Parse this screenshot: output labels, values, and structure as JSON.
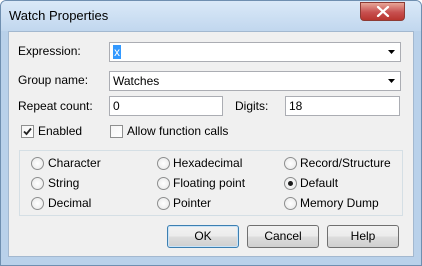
{
  "window": {
    "title": "Watch Properties"
  },
  "form": {
    "expression_label": "Expression:",
    "expression_value": "x",
    "group_label": "Group name:",
    "group_value": "Watches",
    "repeat_label": "Repeat count:",
    "repeat_value": "0",
    "digits_label": "Digits:",
    "digits_value": "18",
    "enabled_label": "Enabled",
    "enabled_checked": true,
    "allow_calls_label": "Allow function calls",
    "allow_calls_checked": false
  },
  "formats": {
    "options": [
      {
        "label": "Character",
        "selected": false
      },
      {
        "label": "Hexadecimal",
        "selected": false
      },
      {
        "label": "Record/Structure",
        "selected": false
      },
      {
        "label": "String",
        "selected": false
      },
      {
        "label": "Floating point",
        "selected": false
      },
      {
        "label": "Default",
        "selected": true
      },
      {
        "label": "Decimal",
        "selected": false
      },
      {
        "label": "Pointer",
        "selected": false
      },
      {
        "label": "Memory Dump",
        "selected": false
      }
    ]
  },
  "buttons": {
    "ok": "OK",
    "cancel": "Cancel",
    "help": "Help"
  },
  "colors": {
    "selection": "#3399ff",
    "close_button": "#c75050",
    "frame": "#b9d1ea"
  },
  "icons": {
    "close": "close-icon",
    "dropdown": "chevron-down-icon",
    "check": "check-mark-icon"
  }
}
